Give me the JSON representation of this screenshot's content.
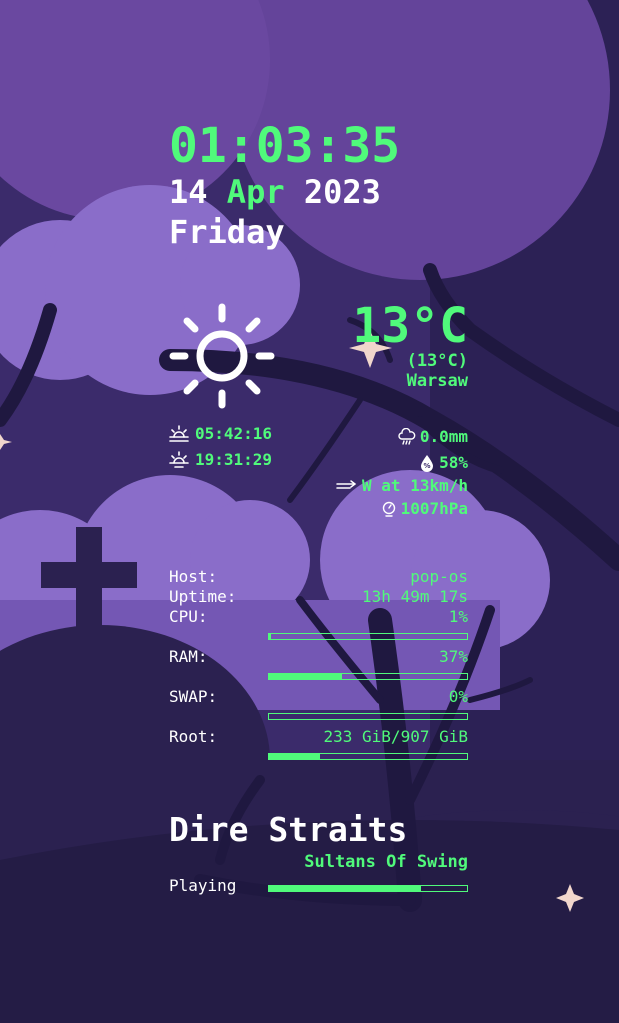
{
  "clock": {
    "time": "01:03:35",
    "day": "14",
    "month": "Apr",
    "year": "2023",
    "weekday": "Friday"
  },
  "weather": {
    "icon": "sun-icon",
    "temperature": "13°C",
    "feels_like": "(13°C)",
    "city": "Warsaw",
    "sunrise": "05:42:16",
    "sunset": "19:31:29",
    "precipitation": "0.0mm",
    "humidity": "58%",
    "wind": "W at 13km/h",
    "pressure": "1007hPa"
  },
  "system": {
    "host_label": "Host:",
    "host": "pop-os",
    "uptime_label": "Uptime:",
    "uptime": "13h 49m 17s",
    "cpu_label": "CPU:",
    "cpu": "1%",
    "cpu_level": 1,
    "ram_label": "RAM:",
    "ram": "37%",
    "ram_level": 37,
    "swap_label": "SWAP:",
    "swap": "0%",
    "swap_level": 0,
    "root_label": "Root:",
    "root": "233 GiB/907 GiB",
    "root_level": 25.7
  },
  "music": {
    "artist": "Dire Straits",
    "track": "Sultans Of Swing",
    "status": "Playing",
    "progress": 77
  },
  "colors": {
    "accent": "#50fa7b",
    "text": "#ffffff",
    "background": "#3d2d6e"
  }
}
